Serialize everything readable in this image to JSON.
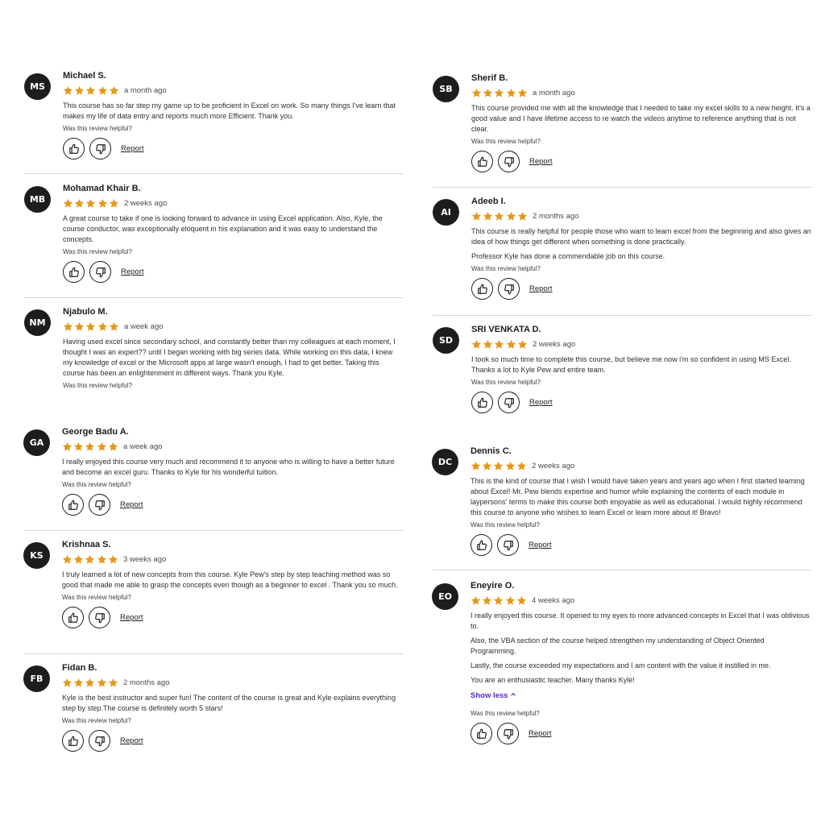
{
  "helpful_label": "Was this review helpful?",
  "report_label": "Report",
  "show_less_label": "Show less",
  "colors": {
    "star": "#e59819",
    "avatar": "#1c1d1f",
    "link": "#5624d0",
    "divider": "#d1d7dc"
  },
  "icons": {
    "rating": "star-icon",
    "like": "thumbs-up-icon",
    "dislike": "thumbs-down-icon",
    "collapse": "chevron-up-icon"
  },
  "reviews": [
    {
      "initials": "MS",
      "name": "Michael S.",
      "rating": 5,
      "time": "a month ago",
      "text": [
        "This course has so far step my game up to be proficient in Excel on work. So many things I've learn that makes my life of data entry and reports much more Efficient. Thank you."
      ],
      "has_actions": true
    },
    {
      "initials": "MB",
      "name": "Mohamad Khair B.",
      "rating": 5,
      "time": "2 weeks ago",
      "text": [
        "A great course to take if one is looking forward to advance in using Excel application. Also, Kyle, the course conductor, was exceptionally eloquent in his explanation and it was easy to understand the concepts."
      ],
      "has_actions": true
    },
    {
      "initials": "NM",
      "name": "Njabulo M.",
      "rating": 5,
      "time": "a week ago",
      "text": [
        "Having used excel since secondary school, and constantly better than my colleagues at each moment, I thought I was an expert?? until I began working with big series data. While working on this data, I knew my knowledge of excel or the Microsoft apps at large wasn't enough, I had to get better. Taking this course has been an enlightenment in different ways. Thank you Kyle."
      ],
      "has_actions": false
    },
    {
      "initials": "GA",
      "name": "George Badu A.",
      "rating": 5,
      "time": "a week ago",
      "text": [
        "I really enjoyed this course very much and recommend it to anyone who is willing to have a better future and become an excel guru. Thanks to Kyle for his wonderful tuition."
      ],
      "has_actions": true
    },
    {
      "initials": "KS",
      "name": "Krishnaa S.",
      "rating": 5,
      "time": "3 weeks ago",
      "text": [
        "I truly learned a lot of new concepts from this course. Kyle Pew's step by step teaching method was so good that made me able to grasp the concepts even though as a beginner to excel . Thank you so much."
      ],
      "has_actions": true
    },
    {
      "initials": "FB",
      "name": "Fidan B.",
      "rating": 5,
      "time": "2 months ago",
      "text": [
        "Kyle is the best instructor and super fun! The content of the course is great and Kyle explains everything step by step.The course is definitely worth 5 stars!"
      ],
      "has_actions": true
    },
    {
      "initials": "SB",
      "name": "Sherif B.",
      "rating": 5,
      "time": "a month ago",
      "text": [
        "This course provided me with all the knowledge that I needed to take my excel skills to a new height. It's a good value and I have lifetime access to re watch the videos anytime to reference anything that is not clear."
      ],
      "has_actions": true
    },
    {
      "initials": "AI",
      "name": "Adeeb I.",
      "rating": 5,
      "time": "2 months ago",
      "text": [
        "This course is really helpful for people those who want to learn excel from the beginning and also gives an idea of how things get different when something is done practically.",
        "Professor Kyle has done a commendable job on this course."
      ],
      "has_actions": true
    },
    {
      "initials": "SD",
      "name": "SRI VENKATA D.",
      "rating": 5,
      "time": "2 weeks ago",
      "text": [
        "I took so much time to complete this course, but believe me now i'm so confident in using MS Excel. Thanks a lot to Kyle Pew and entire team."
      ],
      "has_actions": true
    },
    {
      "initials": "DC",
      "name": "Dennis C.",
      "rating": 5,
      "time": "2 weeks ago",
      "text": [
        "This is the kind of course that I wish I would have taken years and years ago when I first started learning about Excel! Mr. Pew blends expertise and humor while explaining the contents of each module in laypersons' terms to make this course both enjoyable as well as educational. I would highly recommend this course to anyone who wishes to learn Excel or learn more about it! Bravo!"
      ],
      "has_actions": true
    },
    {
      "initials": "EO",
      "name": "Eneyire O.",
      "rating": 5,
      "time": "4 weeks ago",
      "text": [
        "I really enjoyed this course. It opened to my eyes to more advanced concepts in Excel that I was oblivious to.",
        "Also, the VBA section of the course helped strengthen my understanding of Object Oriented Programming.",
        "Lastly, the course exceeded my expectations and I am content with the value it instilled in me.",
        "You are an enthusiastic teacher. Many thanks Kyle!"
      ],
      "has_actions": true,
      "show_less": true
    }
  ]
}
